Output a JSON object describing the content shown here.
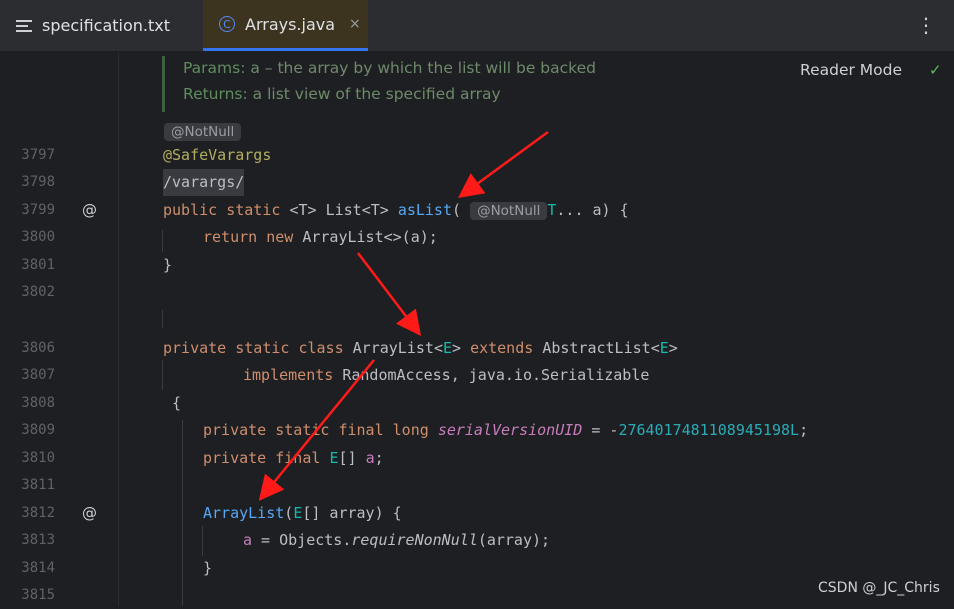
{
  "tabs": [
    {
      "label": "specification.txt",
      "icon": "text-file-icon",
      "active": false
    },
    {
      "label": "Arrays.java",
      "icon": "class-icon",
      "active": true,
      "close": "×"
    }
  ],
  "menu_glyph": "⋮",
  "doc": {
    "params_label": "Params:",
    "params_text": "a – the array by which the list will be backed",
    "returns_label": "Returns:",
    "returns_text": "a list view of the specified array"
  },
  "reader_mode": "Reader Mode",
  "check_glyph": "✓",
  "inlay_notnull": "@NotNull",
  "at_glyph": "@",
  "lines": {
    "l3797": "3797",
    "l3798": "3798",
    "l3799": "3799",
    "l3800": "3800",
    "l3801": "3801",
    "l3802": "3802",
    "l3806": "3806",
    "l3807": "3807",
    "l3808": "3808",
    "l3809": "3809",
    "l3810": "3810",
    "l3811": "3811",
    "l3812": "3812",
    "l3813": "3813",
    "l3814": "3814",
    "l3815": "3815"
  },
  "code": {
    "safe_varargs": "@SafeVarargs",
    "varargs_comment": "/varargs/",
    "public": "public",
    "static": "static",
    "T": "<T>",
    "List": "List",
    "ListT": "<T>",
    "asList": "asList",
    "paren_open": "(",
    "notnull_chip": "@NotNull",
    "Tdots": "T",
    "dots_a": "... a) {",
    "return": "return",
    "new": "new",
    "arraylist_diamond": "ArrayList<>(a);",
    "close_brace": "}",
    "private": "private",
    "class": "class",
    "ArrayList": "ArrayList",
    "lt": "<",
    "E": "E",
    "gt": ">",
    "extends": "extends",
    "AbstractList": "AbstractList",
    "implements": "implements",
    "implements_rest": "RandomAccess, java.io.Serializable",
    "open_brace": "{",
    "final": "final",
    "long": "long",
    "serialVersionUID": "serialVersionUID",
    "eq_minus": " = -",
    "serial_value": "2764017481108945198L",
    "semicolon": ";",
    "E_arr": "E",
    "arr_brackets": "[] ",
    "a": "a",
    "ctor_name": "ArrayList",
    "ctor_open": "(",
    "ctor_E": "E",
    "ctor_rest": "[] array) {",
    "assign_a": "a",
    "assign_mid": " = Objects.",
    "requireNonNull": "requireNonNull",
    "assign_end": "(array);"
  },
  "watermark": "CSDN @_JC_Chris",
  "colors": {
    "annotation_arrow": "#ff1a1a",
    "tab_accent": "#3574f0"
  }
}
